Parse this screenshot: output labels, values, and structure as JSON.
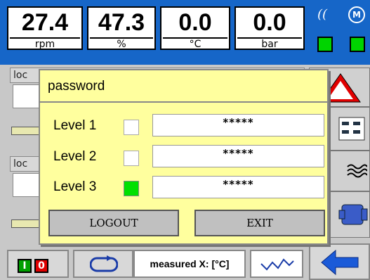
{
  "header": {
    "meters": [
      {
        "value": "27.4",
        "unit": "rpm"
      },
      {
        "value": "47.3",
        "unit": "%"
      },
      {
        "value": "0.0",
        "unit": "°C"
      },
      {
        "value": "0.0",
        "unit": "bar"
      }
    ],
    "signal_glyph": "((",
    "motor_glyph": "M",
    "status_color": "#00d400",
    "brand_color": "#1666c8"
  },
  "background": {
    "row_labels": [
      "loc",
      "loc"
    ]
  },
  "dialog": {
    "title": "password",
    "levels": [
      {
        "label": "Level 1",
        "active": false,
        "value": "*****"
      },
      {
        "label": "Level 2",
        "active": false,
        "value": "*****"
      },
      {
        "label": "Level 3",
        "active": true,
        "value": "*****"
      }
    ],
    "logout_label": "LOGOUT",
    "exit_label": "EXIT",
    "background_color": "#ffff9e"
  },
  "bottom_bar": {
    "io_on": "I",
    "io_off": "0",
    "measured_label": "measured X: [°C]"
  },
  "icons": [
    "warning-triangle-icon",
    "panel-icon",
    "waves-icon",
    "pump-icon",
    "loop-icon",
    "trend-icon",
    "back-arrow-icon"
  ]
}
